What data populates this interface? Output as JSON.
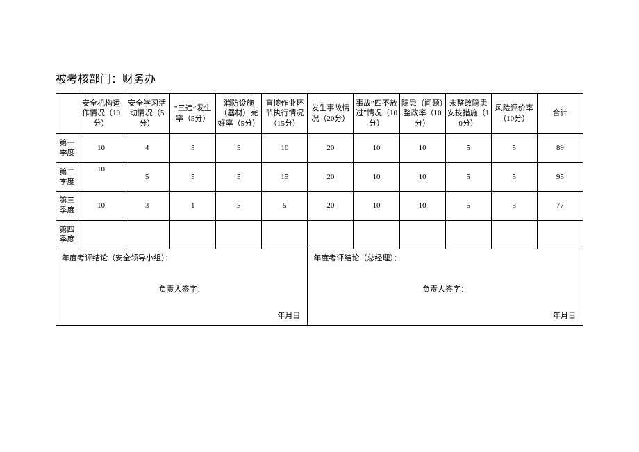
{
  "title": "被考核部门：财务办",
  "headers": {
    "c1": "安全机构运作情况（10分）",
    "c2": "安全学习活动情况（5分）",
    "c3": "“三违”发生率（5分）",
    "c4": "消防设施（器材）完好率（5分）",
    "c5": "直接作业环节执行情况（15分）",
    "c6": "发生事故情况（20分）",
    "c7": "事故“四不放过”情况（10分）",
    "c8": "隐患（问题）整改率（10分）",
    "c9": "未整改隐患安技措施（10分）",
    "c10": "风险评价率（10分）",
    "c11": "合计"
  },
  "rows": {
    "q1": {
      "label": "第一季度",
      "c1": "10",
      "c2": "4",
      "c3": "5",
      "c4": "5",
      "c5": "10",
      "c6": "20",
      "c7": "10",
      "c8": "10",
      "c9": "5",
      "c10": "5",
      "c11": "89"
    },
    "q2": {
      "label": "第二季度",
      "c1": "10",
      "c2": "5",
      "c3": "5",
      "c4": "5",
      "c5": "15",
      "c6": "20",
      "c7": "10",
      "c8": "10",
      "c9": "5",
      "c10": "5",
      "c11": "95"
    },
    "q3": {
      "label": "第三季度",
      "c1": "10",
      "c2": "3",
      "c3": "1",
      "c4": "5",
      "c5": "5",
      "c6": "20",
      "c7": "10",
      "c8": "10",
      "c9": "5",
      "c10": "3",
      "c11": "77"
    },
    "q4": {
      "label": "第四季度",
      "c1": "",
      "c2": "",
      "c3": "",
      "c4": "",
      "c5": "",
      "c6": "",
      "c7": "",
      "c8": "",
      "c9": "",
      "c10": "",
      "c11": ""
    }
  },
  "conclusion": {
    "left_label": "年度考评结论（安全领导小组）：",
    "right_label": "年度考评结论（总经理）：",
    "signer": "负责人签字：",
    "date": "年月日"
  }
}
